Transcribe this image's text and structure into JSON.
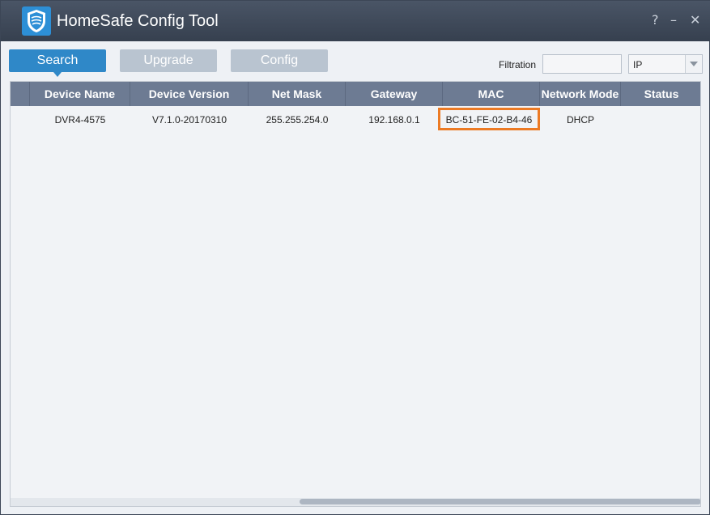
{
  "window": {
    "title": "HomeSafe Config Tool",
    "help_label": "?",
    "minimize_label": "–",
    "close_label": "✕"
  },
  "toolbar": {
    "search_label": "Search",
    "upgrade_label": "Upgrade",
    "config_label": "Config"
  },
  "filter": {
    "label": "Filtration",
    "input_value": "",
    "select_value": "IP"
  },
  "table": {
    "columns": [
      "Device Name",
      "Device Version",
      "Net Mask",
      "Gateway",
      "MAC",
      "Network Mode",
      "Status"
    ],
    "rows": [
      {
        "device_name": "DVR4-4575",
        "device_version": "V7.1.0-20170310",
        "net_mask": "255.255.254.0",
        "gateway": "192.168.0.1",
        "mac": "BC-51-FE-02-B4-46",
        "network_mode": "DHCP",
        "status": ""
      }
    ]
  },
  "colors": {
    "accent": "#2f88c8",
    "highlight": "#ec7a24",
    "header": "#6d7b93",
    "titlebar": "#3c4656"
  },
  "icons": {
    "logo": "shield-logo-icon",
    "dropdown": "chevron-down-icon"
  }
}
